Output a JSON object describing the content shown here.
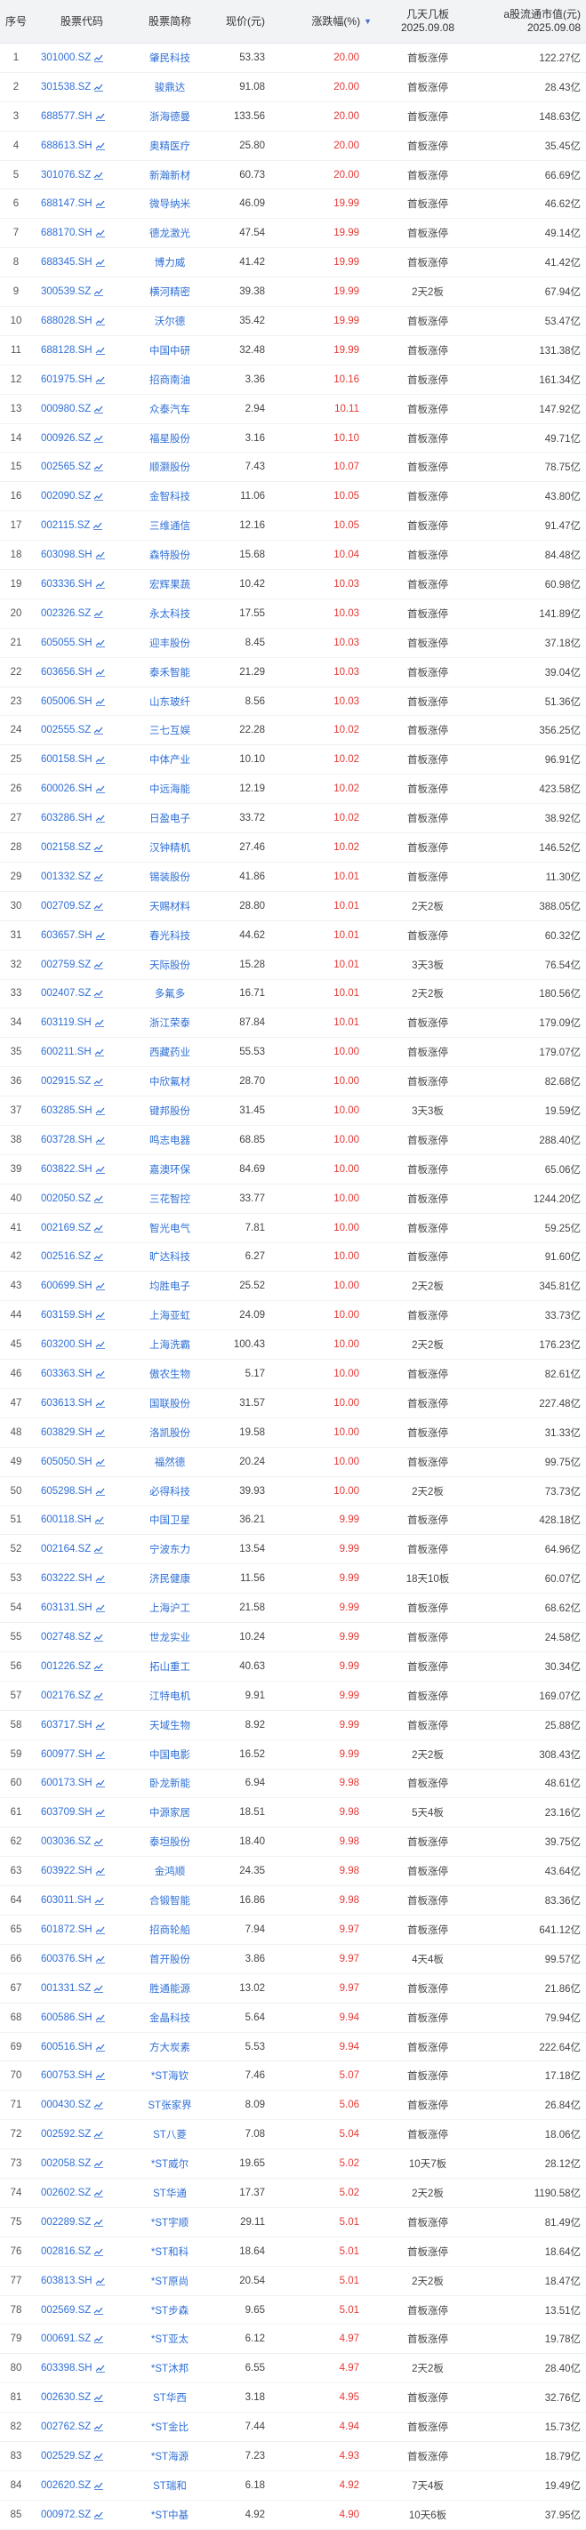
{
  "header": {
    "index": "序号",
    "code": "股票代码",
    "name": "股票简称",
    "price": "现价(元)",
    "change": "涨跌幅(%)",
    "boards_line1": "几天几板",
    "boards_line2": "2025.09.08",
    "mcap_line1": "a股流通市值(元)",
    "mcap_line2": "2025.09.08"
  },
  "rows": [
    {
      "idx": "1",
      "code": "301000.SZ",
      "name": "肇民科技",
      "price": "53.33",
      "chg": "20.00",
      "boards": "首板涨停",
      "mcap": "122.27亿"
    },
    {
      "idx": "2",
      "code": "301538.SZ",
      "name": "骏鼎达",
      "price": "91.08",
      "chg": "20.00",
      "boards": "首板涨停",
      "mcap": "28.43亿"
    },
    {
      "idx": "3",
      "code": "688577.SH",
      "name": "浙海德曼",
      "price": "133.56",
      "chg": "20.00",
      "boards": "首板涨停",
      "mcap": "148.63亿"
    },
    {
      "idx": "4",
      "code": "688613.SH",
      "name": "奥精医疗",
      "price": "25.80",
      "chg": "20.00",
      "boards": "首板涨停",
      "mcap": "35.45亿"
    },
    {
      "idx": "5",
      "code": "301076.SZ",
      "name": "新瀚新材",
      "price": "60.73",
      "chg": "20.00",
      "boards": "首板涨停",
      "mcap": "66.69亿"
    },
    {
      "idx": "6",
      "code": "688147.SH",
      "name": "微导纳米",
      "price": "46.09",
      "chg": "19.99",
      "boards": "首板涨停",
      "mcap": "46.62亿"
    },
    {
      "idx": "7",
      "code": "688170.SH",
      "name": "德龙激光",
      "price": "47.54",
      "chg": "19.99",
      "boards": "首板涨停",
      "mcap": "49.14亿"
    },
    {
      "idx": "8",
      "code": "688345.SH",
      "name": "博力威",
      "price": "41.42",
      "chg": "19.99",
      "boards": "首板涨停",
      "mcap": "41.42亿"
    },
    {
      "idx": "9",
      "code": "300539.SZ",
      "name": "横河精密",
      "price": "39.38",
      "chg": "19.99",
      "boards": "2天2板",
      "mcap": "67.94亿"
    },
    {
      "idx": "10",
      "code": "688028.SH",
      "name": "沃尔德",
      "price": "35.42",
      "chg": "19.99",
      "boards": "首板涨停",
      "mcap": "53.47亿"
    },
    {
      "idx": "11",
      "code": "688128.SH",
      "name": "中国中研",
      "price": "32.48",
      "chg": "19.99",
      "boards": "首板涨停",
      "mcap": "131.38亿"
    },
    {
      "idx": "12",
      "code": "601975.SH",
      "name": "招商南油",
      "price": "3.36",
      "chg": "10.16",
      "boards": "首板涨停",
      "mcap": "161.34亿"
    },
    {
      "idx": "13",
      "code": "000980.SZ",
      "name": "众泰汽车",
      "price": "2.94",
      "chg": "10.11",
      "boards": "首板涨停",
      "mcap": "147.92亿"
    },
    {
      "idx": "14",
      "code": "000926.SZ",
      "name": "福星股份",
      "price": "3.16",
      "chg": "10.10",
      "boards": "首板涨停",
      "mcap": "49.71亿"
    },
    {
      "idx": "15",
      "code": "002565.SZ",
      "name": "顺灏股份",
      "price": "7.43",
      "chg": "10.07",
      "boards": "首板涨停",
      "mcap": "78.75亿"
    },
    {
      "idx": "16",
      "code": "002090.SZ",
      "name": "金智科技",
      "price": "11.06",
      "chg": "10.05",
      "boards": "首板涨停",
      "mcap": "43.80亿"
    },
    {
      "idx": "17",
      "code": "002115.SZ",
      "name": "三维通信",
      "price": "12.16",
      "chg": "10.05",
      "boards": "首板涨停",
      "mcap": "91.47亿"
    },
    {
      "idx": "18",
      "code": "603098.SH",
      "name": "森特股份",
      "price": "15.68",
      "chg": "10.04",
      "boards": "首板涨停",
      "mcap": "84.48亿"
    },
    {
      "idx": "19",
      "code": "603336.SH",
      "name": "宏辉果蔬",
      "price": "10.42",
      "chg": "10.03",
      "boards": "首板涨停",
      "mcap": "60.98亿"
    },
    {
      "idx": "20",
      "code": "002326.SZ",
      "name": "永太科技",
      "price": "17.55",
      "chg": "10.03",
      "boards": "首板涨停",
      "mcap": "141.89亿"
    },
    {
      "idx": "21",
      "code": "605055.SH",
      "name": "迎丰股份",
      "price": "8.45",
      "chg": "10.03",
      "boards": "首板涨停",
      "mcap": "37.18亿"
    },
    {
      "idx": "22",
      "code": "603656.SH",
      "name": "泰禾智能",
      "price": "21.29",
      "chg": "10.03",
      "boards": "首板涨停",
      "mcap": "39.04亿"
    },
    {
      "idx": "23",
      "code": "605006.SH",
      "name": "山东玻纤",
      "price": "8.56",
      "chg": "10.03",
      "boards": "首板涨停",
      "mcap": "51.36亿"
    },
    {
      "idx": "24",
      "code": "002555.SZ",
      "name": "三七互娱",
      "price": "22.28",
      "chg": "10.02",
      "boards": "首板涨停",
      "mcap": "356.25亿"
    },
    {
      "idx": "25",
      "code": "600158.SH",
      "name": "中体产业",
      "price": "10.10",
      "chg": "10.02",
      "boards": "首板涨停",
      "mcap": "96.91亿"
    },
    {
      "idx": "26",
      "code": "600026.SH",
      "name": "中远海能",
      "price": "12.19",
      "chg": "10.02",
      "boards": "首板涨停",
      "mcap": "423.58亿"
    },
    {
      "idx": "27",
      "code": "603286.SH",
      "name": "日盈电子",
      "price": "33.72",
      "chg": "10.02",
      "boards": "首板涨停",
      "mcap": "38.92亿"
    },
    {
      "idx": "28",
      "code": "002158.SZ",
      "name": "汉钟精机",
      "price": "27.46",
      "chg": "10.02",
      "boards": "首板涨停",
      "mcap": "146.52亿"
    },
    {
      "idx": "29",
      "code": "001332.SZ",
      "name": "锡装股份",
      "price": "41.86",
      "chg": "10.01",
      "boards": "首板涨停",
      "mcap": "11.30亿"
    },
    {
      "idx": "30",
      "code": "002709.SZ",
      "name": "天赐材料",
      "price": "28.80",
      "chg": "10.01",
      "boards": "2天2板",
      "mcap": "388.05亿"
    },
    {
      "idx": "31",
      "code": "603657.SH",
      "name": "春光科技",
      "price": "44.62",
      "chg": "10.01",
      "boards": "首板涨停",
      "mcap": "60.32亿"
    },
    {
      "idx": "32",
      "code": "002759.SZ",
      "name": "天际股份",
      "price": "15.28",
      "chg": "10.01",
      "boards": "3天3板",
      "mcap": "76.54亿"
    },
    {
      "idx": "33",
      "code": "002407.SZ",
      "name": "多氟多",
      "price": "16.71",
      "chg": "10.01",
      "boards": "2天2板",
      "mcap": "180.56亿"
    },
    {
      "idx": "34",
      "code": "603119.SH",
      "name": "浙江荣泰",
      "price": "87.84",
      "chg": "10.01",
      "boards": "首板涨停",
      "mcap": "179.09亿"
    },
    {
      "idx": "35",
      "code": "600211.SH",
      "name": "西藏药业",
      "price": "55.53",
      "chg": "10.00",
      "boards": "首板涨停",
      "mcap": "179.07亿"
    },
    {
      "idx": "36",
      "code": "002915.SZ",
      "name": "中欣氟材",
      "price": "28.70",
      "chg": "10.00",
      "boards": "首板涨停",
      "mcap": "82.68亿"
    },
    {
      "idx": "37",
      "code": "603285.SH",
      "name": "键邦股份",
      "price": "31.45",
      "chg": "10.00",
      "boards": "3天3板",
      "mcap": "19.59亿"
    },
    {
      "idx": "38",
      "code": "603728.SH",
      "name": "鸣志电器",
      "price": "68.85",
      "chg": "10.00",
      "boards": "首板涨停",
      "mcap": "288.40亿"
    },
    {
      "idx": "39",
      "code": "603822.SH",
      "name": "嘉澳环保",
      "price": "84.69",
      "chg": "10.00",
      "boards": "首板涨停",
      "mcap": "65.06亿"
    },
    {
      "idx": "40",
      "code": "002050.SZ",
      "name": "三花智控",
      "price": "33.77",
      "chg": "10.00",
      "boards": "首板涨停",
      "mcap": "1244.20亿"
    },
    {
      "idx": "41",
      "code": "002169.SZ",
      "name": "智光电气",
      "price": "7.81",
      "chg": "10.00",
      "boards": "首板涨停",
      "mcap": "59.25亿"
    },
    {
      "idx": "42",
      "code": "002516.SZ",
      "name": "旷达科技",
      "price": "6.27",
      "chg": "10.00",
      "boards": "首板涨停",
      "mcap": "91.60亿"
    },
    {
      "idx": "43",
      "code": "600699.SH",
      "name": "均胜电子",
      "price": "25.52",
      "chg": "10.00",
      "boards": "2天2板",
      "mcap": "345.81亿"
    },
    {
      "idx": "44",
      "code": "603159.SH",
      "name": "上海亚虹",
      "price": "24.09",
      "chg": "10.00",
      "boards": "首板涨停",
      "mcap": "33.73亿"
    },
    {
      "idx": "45",
      "code": "603200.SH",
      "name": "上海洗霸",
      "price": "100.43",
      "chg": "10.00",
      "boards": "2天2板",
      "mcap": "176.23亿"
    },
    {
      "idx": "46",
      "code": "603363.SH",
      "name": "傲农生物",
      "price": "5.17",
      "chg": "10.00",
      "boards": "首板涨停",
      "mcap": "82.61亿"
    },
    {
      "idx": "47",
      "code": "603613.SH",
      "name": "国联股份",
      "price": "31.57",
      "chg": "10.00",
      "boards": "首板涨停",
      "mcap": "227.48亿"
    },
    {
      "idx": "48",
      "code": "603829.SH",
      "name": "洛凯股份",
      "price": "19.58",
      "chg": "10.00",
      "boards": "首板涨停",
      "mcap": "31.33亿"
    },
    {
      "idx": "49",
      "code": "605050.SH",
      "name": "福然德",
      "price": "20.24",
      "chg": "10.00",
      "boards": "首板涨停",
      "mcap": "99.75亿"
    },
    {
      "idx": "50",
      "code": "605298.SH",
      "name": "必得科技",
      "price": "39.93",
      "chg": "10.00",
      "boards": "2天2板",
      "mcap": "73.73亿"
    },
    {
      "idx": "51",
      "code": "600118.SH",
      "name": "中国卫星",
      "price": "36.21",
      "chg": "9.99",
      "boards": "首板涨停",
      "mcap": "428.18亿"
    },
    {
      "idx": "52",
      "code": "002164.SZ",
      "name": "宁波东力",
      "price": "13.54",
      "chg": "9.99",
      "boards": "首板涨停",
      "mcap": "64.96亿"
    },
    {
      "idx": "53",
      "code": "603222.SH",
      "name": "济民健康",
      "price": "11.56",
      "chg": "9.99",
      "boards": "18天10板",
      "mcap": "60.07亿"
    },
    {
      "idx": "54",
      "code": "603131.SH",
      "name": "上海沪工",
      "price": "21.58",
      "chg": "9.99",
      "boards": "首板涨停",
      "mcap": "68.62亿"
    },
    {
      "idx": "55",
      "code": "002748.SZ",
      "name": "世龙实业",
      "price": "10.24",
      "chg": "9.99",
      "boards": "首板涨停",
      "mcap": "24.58亿"
    },
    {
      "idx": "56",
      "code": "001226.SZ",
      "name": "拓山重工",
      "price": "40.63",
      "chg": "9.99",
      "boards": "首板涨停",
      "mcap": "30.34亿"
    },
    {
      "idx": "57",
      "code": "002176.SZ",
      "name": "江特电机",
      "price": "9.91",
      "chg": "9.99",
      "boards": "首板涨停",
      "mcap": "169.07亿"
    },
    {
      "idx": "58",
      "code": "603717.SH",
      "name": "天域生物",
      "price": "8.92",
      "chg": "9.99",
      "boards": "首板涨停",
      "mcap": "25.88亿"
    },
    {
      "idx": "59",
      "code": "600977.SH",
      "name": "中国电影",
      "price": "16.52",
      "chg": "9.99",
      "boards": "2天2板",
      "mcap": "308.43亿"
    },
    {
      "idx": "60",
      "code": "600173.SH",
      "name": "卧龙新能",
      "price": "6.94",
      "chg": "9.98",
      "boards": "首板涨停",
      "mcap": "48.61亿"
    },
    {
      "idx": "61",
      "code": "603709.SH",
      "name": "中源家居",
      "price": "18.51",
      "chg": "9.98",
      "boards": "5天4板",
      "mcap": "23.16亿"
    },
    {
      "idx": "62",
      "code": "003036.SZ",
      "name": "泰坦股份",
      "price": "18.40",
      "chg": "9.98",
      "boards": "首板涨停",
      "mcap": "39.75亿"
    },
    {
      "idx": "63",
      "code": "603922.SH",
      "name": "金鸿顺",
      "price": "24.35",
      "chg": "9.98",
      "boards": "首板涨停",
      "mcap": "43.64亿"
    },
    {
      "idx": "64",
      "code": "603011.SH",
      "name": "合锻智能",
      "price": "16.86",
      "chg": "9.98",
      "boards": "首板涨停",
      "mcap": "83.36亿"
    },
    {
      "idx": "65",
      "code": "601872.SH",
      "name": "招商轮船",
      "price": "7.94",
      "chg": "9.97",
      "boards": "首板涨停",
      "mcap": "641.12亿"
    },
    {
      "idx": "66",
      "code": "600376.SH",
      "name": "首开股份",
      "price": "3.86",
      "chg": "9.97",
      "boards": "4天4板",
      "mcap": "99.57亿"
    },
    {
      "idx": "67",
      "code": "001331.SZ",
      "name": "胜通能源",
      "price": "13.02",
      "chg": "9.97",
      "boards": "首板涨停",
      "mcap": "21.86亿"
    },
    {
      "idx": "68",
      "code": "600586.SH",
      "name": "金晶科技",
      "price": "5.64",
      "chg": "9.94",
      "boards": "首板涨停",
      "mcap": "79.94亿"
    },
    {
      "idx": "69",
      "code": "600516.SH",
      "name": "方大炭素",
      "price": "5.53",
      "chg": "9.94",
      "boards": "首板涨停",
      "mcap": "222.64亿"
    },
    {
      "idx": "70",
      "code": "600753.SH",
      "name": "*ST海钦",
      "price": "7.46",
      "chg": "5.07",
      "boards": "首板涨停",
      "mcap": "17.18亿"
    },
    {
      "idx": "71",
      "code": "000430.SZ",
      "name": "ST张家界",
      "price": "8.09",
      "chg": "5.06",
      "boards": "首板涨停",
      "mcap": "26.84亿"
    },
    {
      "idx": "72",
      "code": "002592.SZ",
      "name": "ST八菱",
      "price": "7.08",
      "chg": "5.04",
      "boards": "首板涨停",
      "mcap": "18.06亿"
    },
    {
      "idx": "73",
      "code": "002058.SZ",
      "name": "*ST威尔",
      "price": "19.65",
      "chg": "5.02",
      "boards": "10天7板",
      "mcap": "28.12亿"
    },
    {
      "idx": "74",
      "code": "002602.SZ",
      "name": "ST华通",
      "price": "17.37",
      "chg": "5.02",
      "boards": "2天2板",
      "mcap": "1190.58亿"
    },
    {
      "idx": "75",
      "code": "002289.SZ",
      "name": "*ST宇顺",
      "price": "29.11",
      "chg": "5.01",
      "boards": "首板涨停",
      "mcap": "81.49亿"
    },
    {
      "idx": "76",
      "code": "002816.SZ",
      "name": "*ST和科",
      "price": "18.64",
      "chg": "5.01",
      "boards": "首板涨停",
      "mcap": "18.64亿"
    },
    {
      "idx": "77",
      "code": "603813.SH",
      "name": "*ST原尚",
      "price": "20.54",
      "chg": "5.01",
      "boards": "2天2板",
      "mcap": "18.47亿"
    },
    {
      "idx": "78",
      "code": "002569.SZ",
      "name": "*ST步森",
      "price": "9.65",
      "chg": "5.01",
      "boards": "首板涨停",
      "mcap": "13.51亿"
    },
    {
      "idx": "79",
      "code": "000691.SZ",
      "name": "*ST亚太",
      "price": "6.12",
      "chg": "4.97",
      "boards": "首板涨停",
      "mcap": "19.78亿"
    },
    {
      "idx": "80",
      "code": "603398.SH",
      "name": "*ST沐邦",
      "price": "6.55",
      "chg": "4.97",
      "boards": "2天2板",
      "mcap": "28.40亿"
    },
    {
      "idx": "81",
      "code": "002630.SZ",
      "name": "ST华西",
      "price": "3.18",
      "chg": "4.95",
      "boards": "首板涨停",
      "mcap": "32.76亿"
    },
    {
      "idx": "82",
      "code": "002762.SZ",
      "name": "*ST金比",
      "price": "7.44",
      "chg": "4.94",
      "boards": "首板涨停",
      "mcap": "15.73亿"
    },
    {
      "idx": "83",
      "code": "002529.SZ",
      "name": "*ST海源",
      "price": "7.23",
      "chg": "4.93",
      "boards": "首板涨停",
      "mcap": "18.79亿"
    },
    {
      "idx": "84",
      "code": "002620.SZ",
      "name": "ST瑞和",
      "price": "6.18",
      "chg": "4.92",
      "boards": "7天4板",
      "mcap": "19.49亿"
    },
    {
      "idx": "85",
      "code": "000972.SZ",
      "name": "*ST中基",
      "price": "4.92",
      "chg": "4.90",
      "boards": "10天6板",
      "mcap": "37.95亿"
    }
  ],
  "colors": {
    "link": "#2f6fd6",
    "up": "#e53935",
    "header_bg": "#f2f3f5"
  }
}
